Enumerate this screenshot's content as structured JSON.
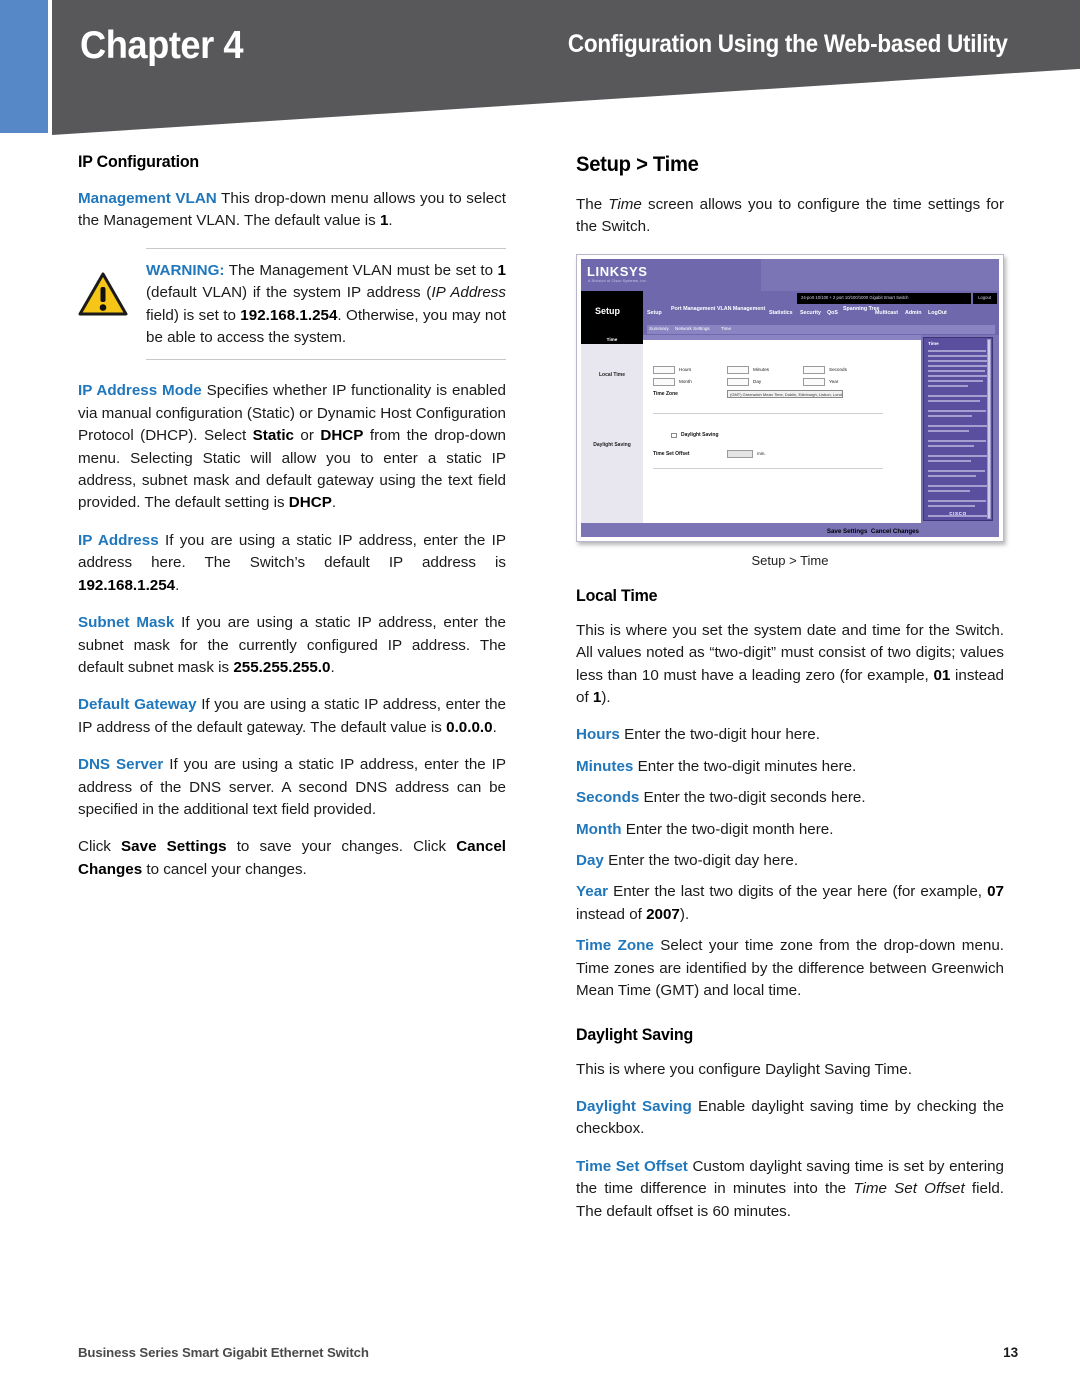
{
  "header": {
    "chapter": "Chapter 4",
    "section_title": "Configuration Using the Web-based Utility",
    "blue_accent": "#5688C7",
    "gray": "#58585A"
  },
  "accent_color": "#2077BC",
  "left_column": {
    "heading": "IP Configuration",
    "mgmt_vlan": {
      "term": "Management VLAN",
      "text_1": " This drop-down menu allows you to select the Management VLAN. The default value is ",
      "bold_1": "1",
      "text_2": "."
    },
    "warning": {
      "label": "WARNING:",
      "t1": " The Management VLAN must be set to ",
      "b1": "1",
      "t2": " (default VLAN) if the system IP address (",
      "i1": "IP Address",
      "t3": " field) is set to ",
      "b2": "192.168.1.254",
      "t4": ". Otherwise, you may not be able to access the system."
    },
    "ip_address_mode": {
      "term": "IP Address Mode",
      "t1": " Specifies whether IP functionality is enabled via manual configuration (Static) or Dynamic Host Configuration Protocol (DHCP). Select ",
      "b1": "Static",
      "t2": " or ",
      "b2": "DHCP",
      "t3": " from the drop-down menu. Selecting Static will allow you to enter a static IP address, subnet mask and default gateway using the text field provided. The default setting is ",
      "b3": "DHCP",
      "t4": "."
    },
    "ip_address": {
      "term": "IP Address",
      "t1": " If you are using a static IP address, enter the IP address here.  The Switch’s default IP address is ",
      "b1": "192.168.1.254",
      "t2": "."
    },
    "subnet_mask": {
      "term": "Subnet Mask",
      "t1": " If you are using a static IP address, enter the subnet mask for the currently configured IP address. The default subnet mask is ",
      "b1": "255.255.255.0",
      "t2": "."
    },
    "default_gateway": {
      "term": "Default Gateway",
      "t1": " If you are using a static IP address, enter the IP address of the default gateway. The default value is ",
      "b1": "0.0.0.0",
      "t2": "."
    },
    "dns_server": {
      "term": "DNS Server",
      "t1": " If you are using a static IP address, enter the IP address of the DNS server. A second DNS address can be specified in the additional text field provided."
    },
    "save_note": {
      "t1": "Click ",
      "b1": "Save Settings",
      "t2": " to save your changes. Click ",
      "b2": "Cancel Changes",
      "t3": " to cancel your changes."
    }
  },
  "right_column": {
    "heading": "Setup > Time",
    "intro": {
      "t1": "The ",
      "i1": "Time",
      "t2": " screen allows you to configure the time settings for the Switch."
    },
    "figure_caption": "Setup > Time",
    "local_time_heading": "Local Time",
    "local_time_intro": {
      "t1": "This is where you set the system date and time for the Switch. All values noted as “two-digit” must consist of two digits; values less than 10 must have a leading zero (for example, ",
      "b1": "01",
      "t2": " instead of ",
      "b2": "1",
      "t3": ")."
    },
    "fields": [
      {
        "term": "Hours",
        "desc": " Enter the two-digit hour here."
      },
      {
        "term": "Minutes",
        "desc": " Enter the two-digit minutes here."
      },
      {
        "term": "Seconds",
        "desc": " Enter the two-digit seconds here."
      },
      {
        "term": "Month",
        "desc": " Enter the two-digit month here."
      },
      {
        "term": "Day",
        "desc": " Enter the two-digit day here."
      }
    ],
    "year": {
      "term": "Year",
      "t1": " Enter the last two digits of the year here (for example, ",
      "b1": "07",
      "t2": " instead of ",
      "b2": "2007",
      "t3": ")."
    },
    "time_zone": {
      "term": "Time Zone",
      "t1": " Select your time zone from the drop-down menu. Time zones are identified by the difference between Greenwich Mean Time (GMT) and local time."
    },
    "daylight_heading": "Daylight Saving",
    "daylight_intro": "This is where you configure Daylight Saving Time.",
    "daylight_saving": {
      "term": "Daylight Saving",
      "t1": " Enable daylight saving time by checking the checkbox."
    },
    "time_set_offset": {
      "term": "Time Set Offset",
      "t1": " Custom daylight saving time is set by entering the time difference in minutes into the ",
      "i1": "Time Set Offset",
      "t2": " field. The default offset is 60 minutes."
    }
  },
  "screenshot": {
    "brand": "LINKSYS",
    "brand_sub": "A Division of Cisco Systems, Inc.",
    "setup_tab": "Setup",
    "model": "24-port 10/100 + 2 port 10/100/1000 Gigabit Smart Switch",
    "logout": "Logout",
    "nav": [
      "Setup",
      "Port Management",
      "VLAN Management",
      "Statistics",
      "Security",
      "QoS",
      "Spanning Tree",
      "Multicast",
      "Admin",
      "LogOut"
    ],
    "subnav": [
      "Summary",
      "Network Settings",
      "Time"
    ],
    "side_header": "Time",
    "side_items": [
      "Local Time",
      "Daylight Saving"
    ],
    "form_labels": [
      "Hours",
      "Minutes",
      "Seconds",
      "Month",
      "Day",
      "Year"
    ],
    "time_zone_label": "Time Zone",
    "time_zone_value": "(GMT) Greenwich Mean Time, Dublin, Edinburgh, Lisbon, London",
    "daylight_checkbox_label": "Daylight Saving",
    "time_set_offset_label": "Time Set Offset",
    "time_set_offset_unit": "min.",
    "save_button": "Save Settings",
    "cancel_button": "Cancel Changes",
    "help_title": "Time",
    "cisco_logo": "CISCO"
  },
  "footer": {
    "left": "Business Series Smart Gigabit Ethernet Switch",
    "page": "13"
  }
}
